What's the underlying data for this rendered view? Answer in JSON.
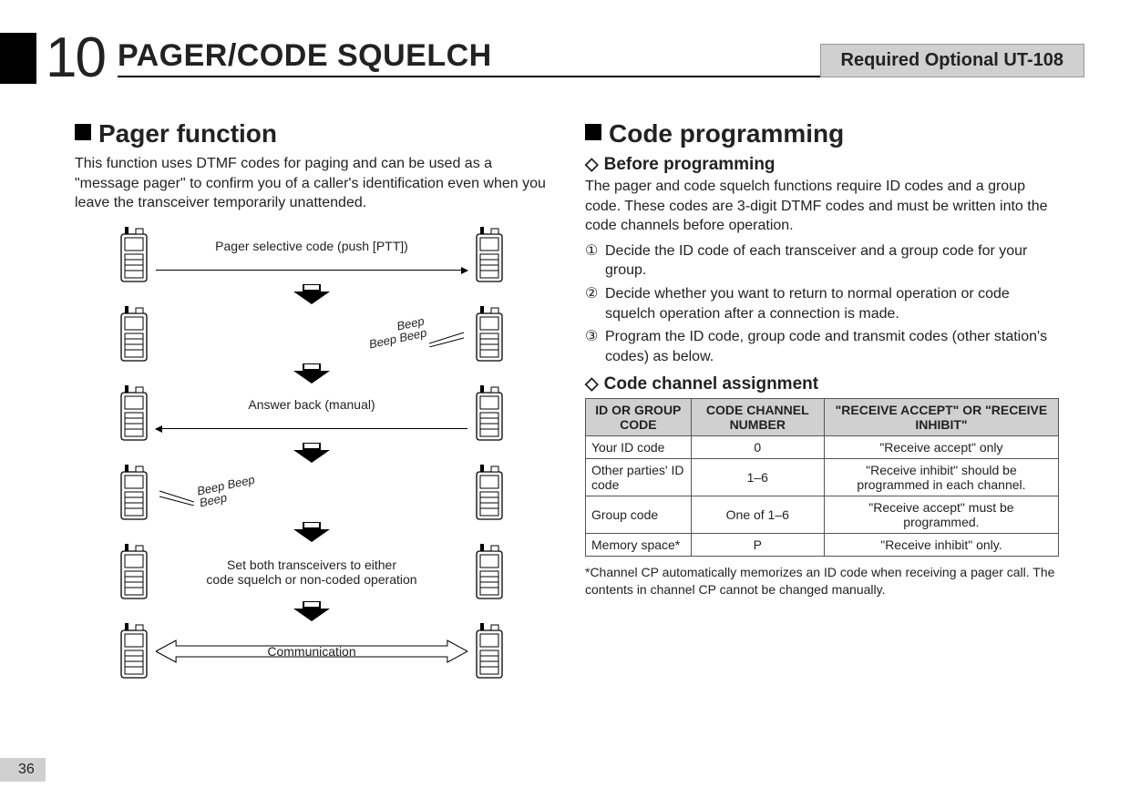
{
  "header": {
    "chapter_number": "10",
    "chapter_title": "PAGER/CODE SQUELCH",
    "required_box": "Required Optional UT-108"
  },
  "left": {
    "h2": "Pager function",
    "intro": "This function uses DTMF codes for paging and can be used as a \"message pager\" to confirm you of a caller's identification even when you leave the transceiver temporarily unattended.",
    "diagram": {
      "row1": "Pager selective code (push [PTT])",
      "beep1": "Beep",
      "beep2": "Beep",
      "beep3": "Beep",
      "row3": "Answer back (manual)",
      "row5a": "Set both transceivers to either",
      "row5b": "code squelch or non-coded operation",
      "row6": "Communication"
    }
  },
  "right": {
    "h2": "Code programming",
    "h3a": "Before programming",
    "p1": "The pager and code squelch functions require ID codes and a group code. These codes are 3-digit DTMF codes and must be written into the code channels before operation.",
    "steps": {
      "n1": "①",
      "t1": "Decide the ID code of each transceiver and a group code for your group.",
      "n2": "②",
      "t2": "Decide whether you want to return to normal operation or code squelch operation after a connection is made.",
      "n3": "③",
      "t3": "Program the ID code, group code and transmit codes (other station's codes) as below."
    },
    "h3b": "Code channel assignment",
    "table": {
      "th1": "ID OR GROUP CODE",
      "th2": "CODE CHANNEL NUMBER",
      "th3": "\"RECEIVE ACCEPT\" OR \"RECEIVE INHIBIT\"",
      "r1c1": "Your ID code",
      "r1c2": "0",
      "r1c3": "\"Receive accept\" only",
      "r2c1": "Other parties' ID code",
      "r2c2": "1–6",
      "r2c3": "\"Receive inhibit\" should be programmed in each channel.",
      "r3c1": "Group code",
      "r3c2": "One of 1–6",
      "r3c3": "\"Receive accept\" must be programmed.",
      "r4c1": "Memory space*",
      "r4c2": "P",
      "r4c3": "\"Receive inhibit\" only."
    },
    "foot": "*Channel CP automatically memorizes an ID code when receiving a pager call. The contents in channel CP cannot be changed manually."
  },
  "page_number": "36"
}
